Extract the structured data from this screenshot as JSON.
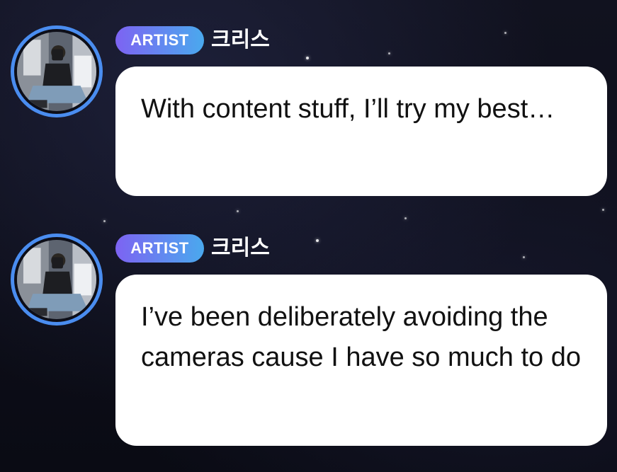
{
  "messages": [
    {
      "badge": "ARTIST",
      "author": "크리스",
      "text": "With content stuff, I’ll try my best…"
    },
    {
      "badge": "ARTIST",
      "author": "크리스",
      "text": "I’ve been deliberately avoiding the cameras cause I have so much to do"
    }
  ],
  "colors": {
    "background": "#0b0c16",
    "bubble": "#ffffff",
    "avatar_ring": "#4a8df0",
    "badge_gradient_start": "#7d63f2",
    "badge_gradient_end": "#4aa9ee"
  }
}
